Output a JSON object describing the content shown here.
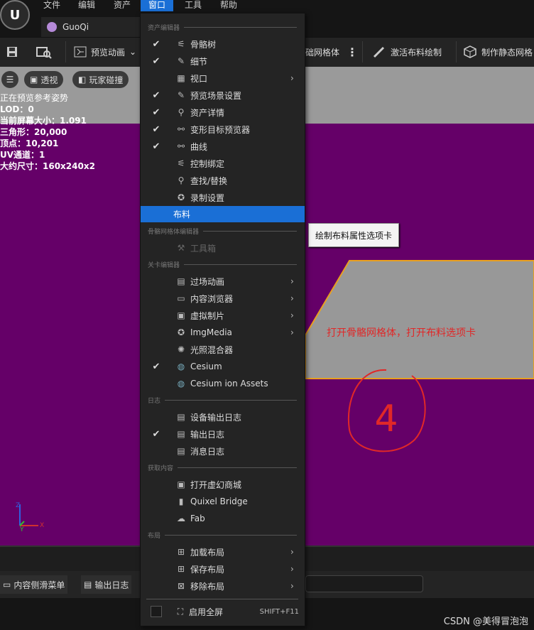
{
  "menubar": {
    "items": [
      {
        "label": "文件"
      },
      {
        "label": "编辑"
      },
      {
        "label": "资产"
      },
      {
        "label": "窗口"
      },
      {
        "label": "工具"
      },
      {
        "label": "帮助"
      }
    ]
  },
  "tab": {
    "label": "GuoQi"
  },
  "toolbar": {
    "preview_anim": "预览动画",
    "mesh_partial": "础网格体",
    "activate_cloth": "激活布料绘制",
    "make_static": "制作静态网格"
  },
  "viewport": {
    "btn_perspective": "透视",
    "btn_collision": "玩家碰撞",
    "stats": [
      "正在预览参考姿势",
      "LOD：0",
      "当前屏幕大小：1.091",
      "三角形：20,000",
      "顶点：10,201",
      "UV通道：1",
      "大约尺寸：160x240x2"
    ],
    "annotation": "打开骨骼网格体，打开布料选项卡",
    "handwritten": "4",
    "tooltip": "绘制布料属性选项卡"
  },
  "bottom": {
    "content_drawer": "内容侧滑菜单",
    "output_log": "输出日志",
    "watermark": "CSDN @美得冒泡泡"
  },
  "dropdown": {
    "sections": {
      "asset_editor": "资产编辑器",
      "skel_editor": "骨骼网格体编辑器",
      "level_editor": "关卡编辑器",
      "log": "日志",
      "get_content": "获取内容",
      "layout": "布局"
    },
    "items": [
      {
        "label": "骨骼树",
        "checked": "✔"
      },
      {
        "label": "细节",
        "checked": "✔"
      },
      {
        "label": "视口",
        "checked": "",
        "arrow": "›"
      },
      {
        "label": "预览场景设置",
        "checked": "✔"
      },
      {
        "label": "资产详情",
        "checked": "✔"
      },
      {
        "label": "变形目标预览器",
        "checked": "✔"
      },
      {
        "label": "曲线",
        "checked": "✔"
      },
      {
        "label": "控制绑定",
        "checked": ""
      },
      {
        "label": "查找/替换",
        "checked": ""
      },
      {
        "label": "录制设置",
        "checked": ""
      },
      {
        "label": "布料",
        "checked": ""
      },
      {
        "label": "工具箱",
        "checked": ""
      },
      {
        "label": "过场动画",
        "checked": "",
        "arrow": "›"
      },
      {
        "label": "内容浏览器",
        "checked": "",
        "arrow": "›"
      },
      {
        "label": "虚拟制片",
        "checked": "",
        "arrow": "›"
      },
      {
        "label": "ImgMedia",
        "checked": "",
        "arrow": "›"
      },
      {
        "label": "光照混合器",
        "checked": ""
      },
      {
        "label": "Cesium",
        "checked": "✔"
      },
      {
        "label": "Cesium ion Assets",
        "checked": ""
      },
      {
        "label": "设备输出日志",
        "checked": ""
      },
      {
        "label": "输出日志",
        "checked": "✔"
      },
      {
        "label": "消息日志",
        "checked": ""
      },
      {
        "label": "打开虚幻商城",
        "checked": ""
      },
      {
        "label": "Quixel Bridge",
        "checked": ""
      },
      {
        "label": "Fab",
        "checked": ""
      },
      {
        "label": "加载布局",
        "checked": "",
        "arrow": "›"
      },
      {
        "label": "保存布局",
        "checked": "",
        "arrow": "›"
      },
      {
        "label": "移除布局",
        "checked": "",
        "arrow": "›"
      },
      {
        "label": "启用全屏",
        "checked": "",
        "shortcut": "SHIFT+F11"
      }
    ]
  },
  "colors": {
    "accent": "#1a6fd6",
    "viewport_purple": "#650068",
    "annotation_red": "#e02828"
  }
}
